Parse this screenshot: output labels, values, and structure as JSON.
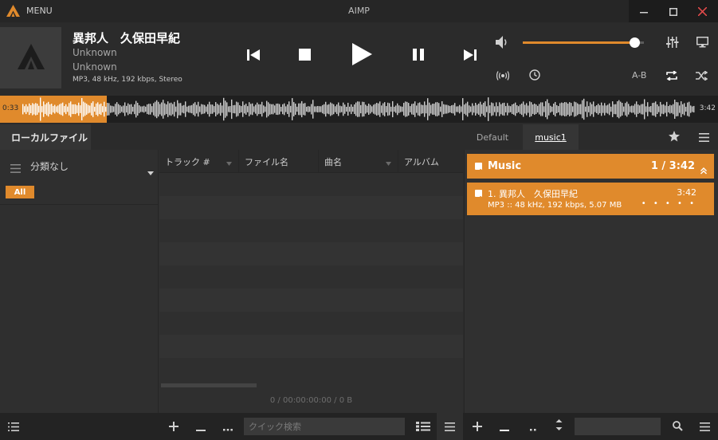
{
  "window": {
    "menu_label": "MENU",
    "title": "AIMP"
  },
  "now_playing": {
    "title": "異邦人　久保田早紀",
    "artist": "Unknown",
    "album": "Unknown",
    "format": "MP3, 48 kHz, 192 kbps, Stereo",
    "volume_fraction": 0.93,
    "ab_label": "A-B"
  },
  "position": {
    "current": "0:33",
    "total": "3:42",
    "progress_fraction": 0.149
  },
  "library": {
    "tab_label": "ローカルファイル",
    "category_label": "分類なし",
    "all_badge": "All",
    "columns": [
      "トラック #",
      "ファイル名",
      "曲名",
      "アルバム"
    ],
    "status": "0 / 00:00:00:00 / 0 B",
    "search_placeholder": "クイック検索"
  },
  "playlist": {
    "tabs": [
      "Default",
      "music1"
    ],
    "active_tab": "music1",
    "group": {
      "name": "Music",
      "summary": "1 / 3:42"
    },
    "items": [
      {
        "title": "1. 異邦人　久保田早紀",
        "details": "MP3 :: 48 kHz, 192 kbps, 5.07 MB",
        "duration": "3:42",
        "rating": "• • • • •"
      }
    ]
  },
  "colors": {
    "accent": "#e08a2c",
    "background": "#2b2b2b",
    "panel": "#2f2f2f",
    "titlebar": "#262626"
  }
}
